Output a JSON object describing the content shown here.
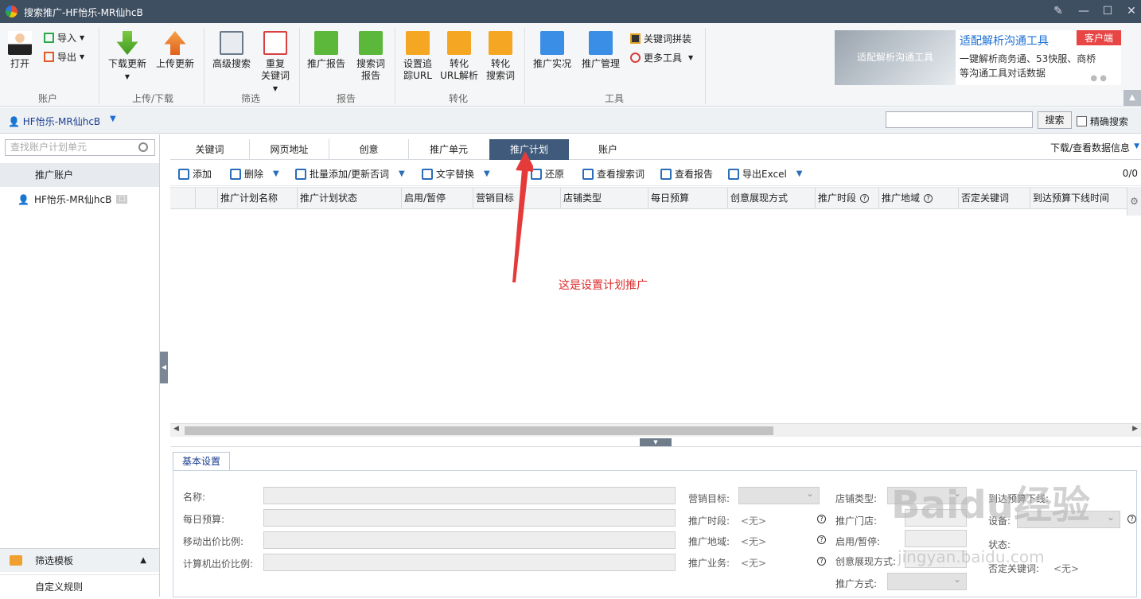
{
  "window": {
    "title": "搜索推广-HF怡乐-MR仙hcB"
  },
  "ribbon": {
    "groups": {
      "account": "账户",
      "updown": "上传/下载",
      "filter": "筛选",
      "report": "报告",
      "convert": "转化",
      "tools": "工具"
    },
    "open": "打开",
    "import": "导入",
    "export": "导出",
    "download_update": "下载更新",
    "upload_update": "上传更新",
    "adv_search": "高级搜索",
    "dup_kw_1": "重复",
    "dup_kw_2": "关键词",
    "promo_report": "推广报告",
    "sq_report_1": "搜索词",
    "sq_report_2": "报告",
    "set_track_1": "设置追",
    "set_track_2": "踪URL",
    "conv_url_1": "转化",
    "conv_url_2": "URL解析",
    "conv_sq_1": "转化",
    "conv_sq_2": "搜索词",
    "promo_live": "推广实况",
    "promo_mgmt": "推广管理",
    "kw_concat": "关键词拼装",
    "more_tools": "更多工具"
  },
  "ad": {
    "image_text": "适配解析沟通工具",
    "headline": "适配解析沟通工具",
    "desc": "一键解析商务通、53快服、商桥等沟通工具对话数据",
    "tag": "客户端"
  },
  "acctbar": {
    "user": "HF怡乐-MR仙hcB",
    "search_btn": "搜索",
    "exact": "精确搜索"
  },
  "left": {
    "find_placeholder": "查找账户计划单元",
    "tree_head": "推广账户",
    "account": "HF怡乐-MR仙hcB",
    "filter_tpl": "筛选模板",
    "custom_rules": "自定义规则"
  },
  "tabs": [
    "关键词",
    "网页地址",
    "创意",
    "推广单元",
    "推广计划",
    "账户"
  ],
  "tabs_right": "下载/查看数据信息",
  "actions": {
    "add": "添加",
    "delete": "删除",
    "batch": "批量添加/更新否词",
    "text_replace": "文字替换",
    "restore": "还原",
    "view_sq": "查看搜索词",
    "view_report": "查看报告",
    "export_excel": "导出Excel",
    "count": "0/0"
  },
  "grid_cols": [
    "推广计划名称",
    "推广计划状态",
    "启用/暂停",
    "营销目标",
    "店铺类型",
    "每日预算",
    "创意展现方式",
    "推广时段",
    "推广地域",
    "否定关键词",
    "到达预算下线时间"
  ],
  "detail": {
    "tab": "基本设置",
    "name": "名称:",
    "daily_budget": "每日预算:",
    "mobile_ratio": "移动出价比例:",
    "pc_ratio": "计算机出价比例:",
    "goal": "营销目标:",
    "period": "推广时段:",
    "region": "推广地域:",
    "business": "推广业务:",
    "none": "<无>",
    "shop_type": "店铺类型:",
    "store": "推广门店:",
    "enable": "启用/暂停:",
    "creative_mode": "创意展现方式:",
    "promo_mode": "推广方式:",
    "budget_offline": "到达预算下线:",
    "device": "设备:",
    "status": "状态:",
    "neg_kw": "否定关键词:"
  },
  "annotation": "这是设置计划推广",
  "watermark": {
    "brand": "Baidu经验",
    "site": "jingyan.baidu.com"
  },
  "colors": {
    "titlebar": "#3e4f62",
    "active_tab": "#3f5a7b",
    "annotation": "#e02a2a",
    "link": "#1a6fd6"
  }
}
